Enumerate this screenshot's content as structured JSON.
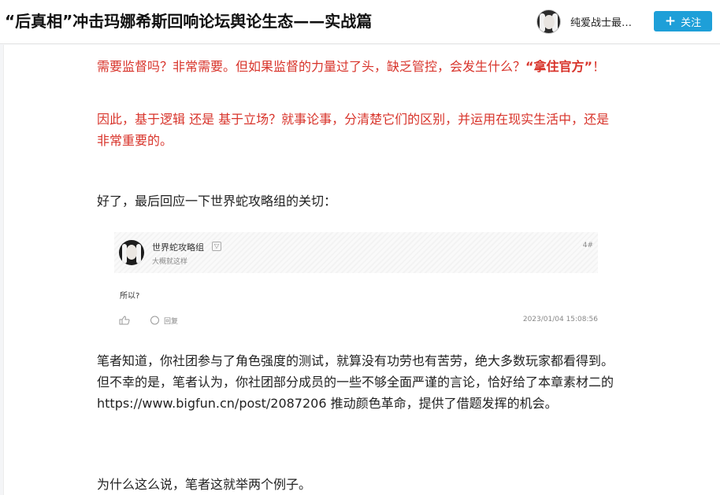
{
  "header": {
    "title": "“后真相”冲击玛娜希斯回响论坛舆论生态——实战篇",
    "author_name": "纯爱战士最…",
    "follow_label": "关注",
    "follow_icon": "plus-icon",
    "accent_color": "#1e9fd8"
  },
  "article": {
    "p1_text": "需要监督吗？非常需要。但如果监督的力量过了头，缺乏管控，会发生什么？",
    "p1_bold": "“拿住官方”",
    "p1_end": "！",
    "p2_text": "因此，基于逻辑 还是 基于立场？就事论事，分清楚它们的区别，并运用在现实生活中，还是非常重要的。",
    "p3_text": "好了，最后回应一下世界蛇攻略组的关切：",
    "p4_text": "笔者知道，你社团参与了角色强度的测试，就算没有功劳也有苦劳，绝大多数玩家都看得到。但不幸的是，笔者认为，你社团部分成员的一些不够全面严谨的言论，恰好给了本章素材二的https://www.bigfun.cn/post/2087206 推动颜色革命，提供了借题发挥的机会。",
    "p5_text": "为什么这么说，笔者这就举两个例子。",
    "highlight_color": "#d8342b"
  },
  "embed": {
    "username": "世界蛇攻略组",
    "subtitle": "大概就这样",
    "floor": "4#",
    "body": "所以?",
    "reply_label": "回复",
    "timestamp": "2023/01/04 15:08:56"
  }
}
